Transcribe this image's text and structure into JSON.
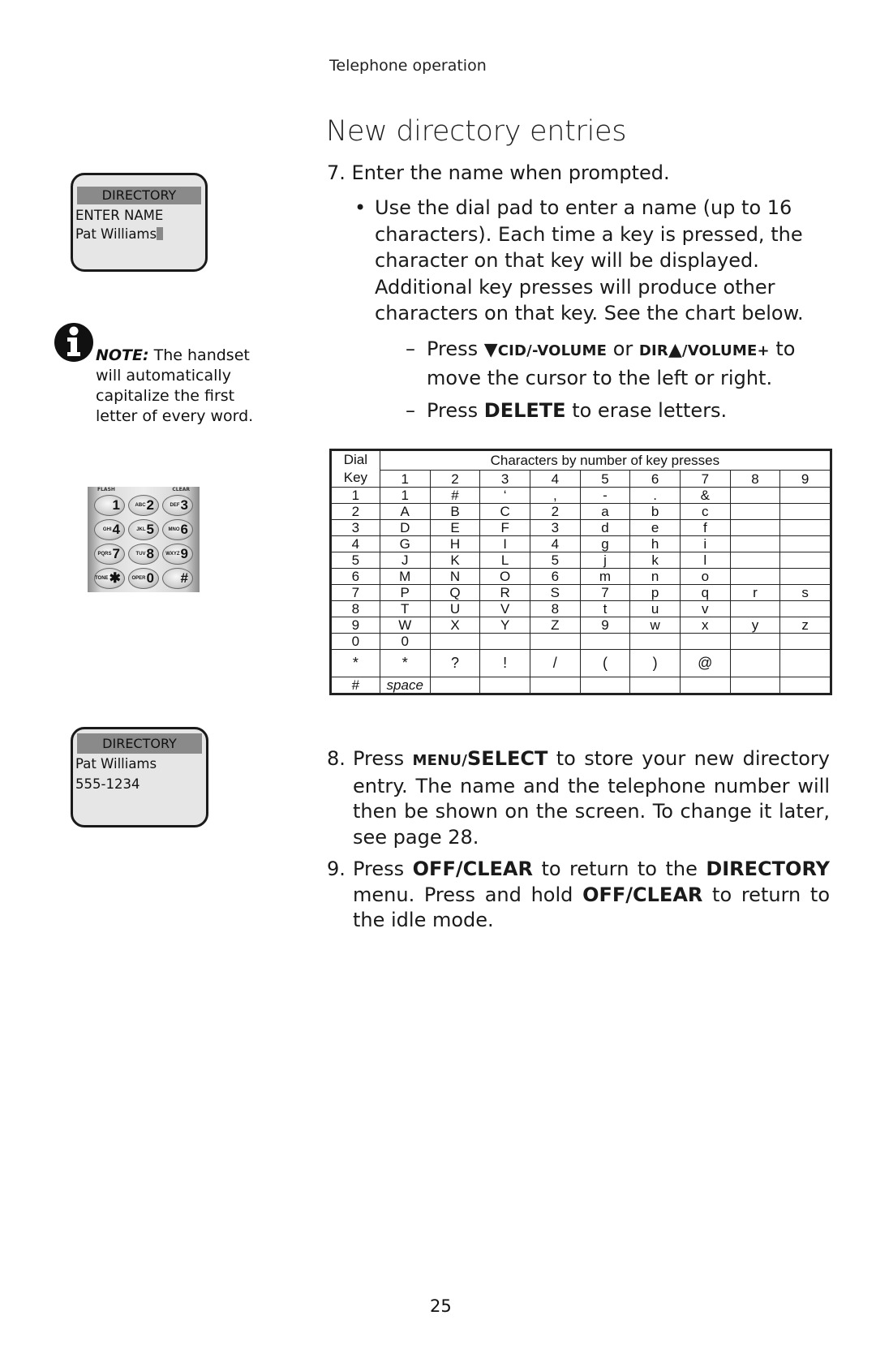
{
  "header": {
    "running_head": "Telephone operation",
    "title": "New directory entries"
  },
  "lcd_enter_name": {
    "header": "DIRECTORY",
    "line1": "ENTER NAME",
    "line2": "Pat Williams"
  },
  "note": {
    "icon": "info-icon",
    "label": "NOTE:",
    "text": " The handset will automatically capitalize the first letter of every word."
  },
  "keypad": {
    "top_left_label": "FLASH",
    "top_right_label": "CLEAR",
    "keys": [
      {
        "sub": "",
        "main": "1"
      },
      {
        "sub": "ABC",
        "main": "2"
      },
      {
        "sub": "DEF",
        "main": "3"
      },
      {
        "sub": "GHI",
        "main": "4"
      },
      {
        "sub": "JKL",
        "main": "5"
      },
      {
        "sub": "MNO",
        "main": "6"
      },
      {
        "sub": "PQRS",
        "main": "7"
      },
      {
        "sub": "TUV",
        "main": "8"
      },
      {
        "sub": "WXYZ",
        "main": "9"
      },
      {
        "sub": "TONE",
        "main": "✱"
      },
      {
        "sub": "OPER",
        "main": "0"
      },
      {
        "sub": "",
        "main": "#"
      }
    ]
  },
  "lcd_saved": {
    "header": "DIRECTORY",
    "line1": "Pat Williams",
    "line2": "555-1234"
  },
  "step7": {
    "number": "7.",
    "text": "Enter the name when prompted.",
    "bullet_mark": "•",
    "bullet_text": "Use the dial pad to enter a name (up to 16 characters). Each time a key is pressed, the character on that key will be displayed. Additional key presses will produce other characters on that key. See the chart below.",
    "dash_mark": "–",
    "dash1": {
      "press": "Press ",
      "down_arrow": "▼",
      "key1": "CID/-VOLUME",
      "or": " or ",
      "key2a": "DIR",
      "up_arrow": "▲",
      "key2b": "/VOLUME+",
      "rest": " to move the cursor to the left or right."
    },
    "dash2": {
      "press": "Press ",
      "key": "DELETE",
      "rest": " to erase letters."
    }
  },
  "char_table": {
    "dial_header_line1": "Dial",
    "dial_header_line2": "Key",
    "group_header": "Characters by number of key presses",
    "press_counts": [
      "1",
      "2",
      "3",
      "4",
      "5",
      "6",
      "7",
      "8",
      "9"
    ],
    "rows": [
      {
        "key": "1",
        "chars": [
          "1",
          "#",
          "‘",
          ",",
          "-",
          ".",
          "&",
          "",
          ""
        ]
      },
      {
        "key": "2",
        "chars": [
          "A",
          "B",
          "C",
          "2",
          "a",
          "b",
          "c",
          "",
          ""
        ]
      },
      {
        "key": "3",
        "chars": [
          "D",
          "E",
          "F",
          "3",
          "d",
          "e",
          "f",
          "",
          ""
        ]
      },
      {
        "key": "4",
        "chars": [
          "G",
          "H",
          "I",
          "4",
          "g",
          "h",
          "i",
          "",
          ""
        ]
      },
      {
        "key": "5",
        "chars": [
          "J",
          "K",
          "L",
          "5",
          "j",
          "k",
          "l",
          "",
          ""
        ]
      },
      {
        "key": "6",
        "chars": [
          "M",
          "N",
          "O",
          "6",
          "m",
          "n",
          "o",
          "",
          ""
        ]
      },
      {
        "key": "7",
        "chars": [
          "P",
          "Q",
          "R",
          "S",
          "7",
          "p",
          "q",
          "r",
          "s"
        ]
      },
      {
        "key": "8",
        "chars": [
          "T",
          "U",
          "V",
          "8",
          "t",
          "u",
          "v",
          "",
          ""
        ]
      },
      {
        "key": "9",
        "chars": [
          "W",
          "X",
          "Y",
          "Z",
          "9",
          "w",
          "x",
          "y",
          "z"
        ]
      },
      {
        "key": "0",
        "chars": [
          "0",
          "",
          "",
          "",
          "",
          "",
          "",
          "",
          ""
        ]
      },
      {
        "key": "*",
        "chars": [
          "*",
          "?",
          "!",
          "/",
          "(",
          ")",
          "@",
          "",
          ""
        ]
      },
      {
        "key": "#",
        "chars": [
          "space",
          "",
          "",
          "",
          "",
          "",
          "",
          "",
          ""
        ]
      }
    ]
  },
  "step8": {
    "number": "8.",
    "press": "Press ",
    "key_a": "MENU/",
    "key_b": "SELECT",
    "rest": " to store your new directory entry. The name and the telephone number will then be shown on the screen. To change it later, see page 28."
  },
  "step9": {
    "number": "9.",
    "press": "Press ",
    "key1": "OFF/CLEAR",
    "mid1": " to return to the ",
    "key2": "DIRECTORY",
    "mid2": " menu. Press and hold ",
    "key3": "OFF/CLEAR",
    "rest": " to return to the idle mode."
  },
  "footer": {
    "page_number": "25"
  }
}
